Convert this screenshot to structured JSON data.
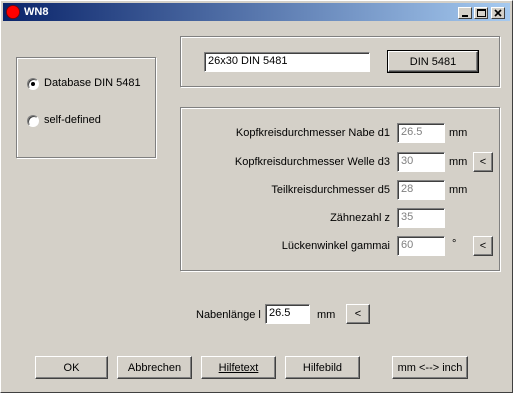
{
  "window": {
    "title": "WN8"
  },
  "database": {
    "options": [
      {
        "label": "Database DIN 5481",
        "selected": true
      },
      {
        "label": "self-defined",
        "selected": false
      }
    ],
    "selection_value": "26x30  DIN 5481",
    "button_label": "DIN 5481"
  },
  "params": [
    {
      "label": "Kopfkreisdurchmesser Nabe d1",
      "value": "26.5",
      "unit": "mm",
      "has_arrow": false
    },
    {
      "label": "Kopfkreisdurchmesser Welle d3",
      "value": "30",
      "unit": "mm",
      "has_arrow": true
    },
    {
      "label": "Teilkreisdurchmesser d5",
      "value": "28",
      "unit": "mm",
      "has_arrow": false
    },
    {
      "label": "Zähnezahl z",
      "value": "35",
      "unit": "",
      "has_arrow": false
    },
    {
      "label": "Lückenwinkel gammai",
      "value": "60",
      "unit": "°",
      "has_arrow": true
    }
  ],
  "arrow_label": "<",
  "hub": {
    "label": "Nabenlänge l",
    "value": "26.5",
    "unit": "mm"
  },
  "buttons": {
    "ok": "OK",
    "cancel": "Abbrechen",
    "help_text": "Hilfetext",
    "help_image": "Hilfebild",
    "unit_toggle": "mm <--> inch"
  }
}
